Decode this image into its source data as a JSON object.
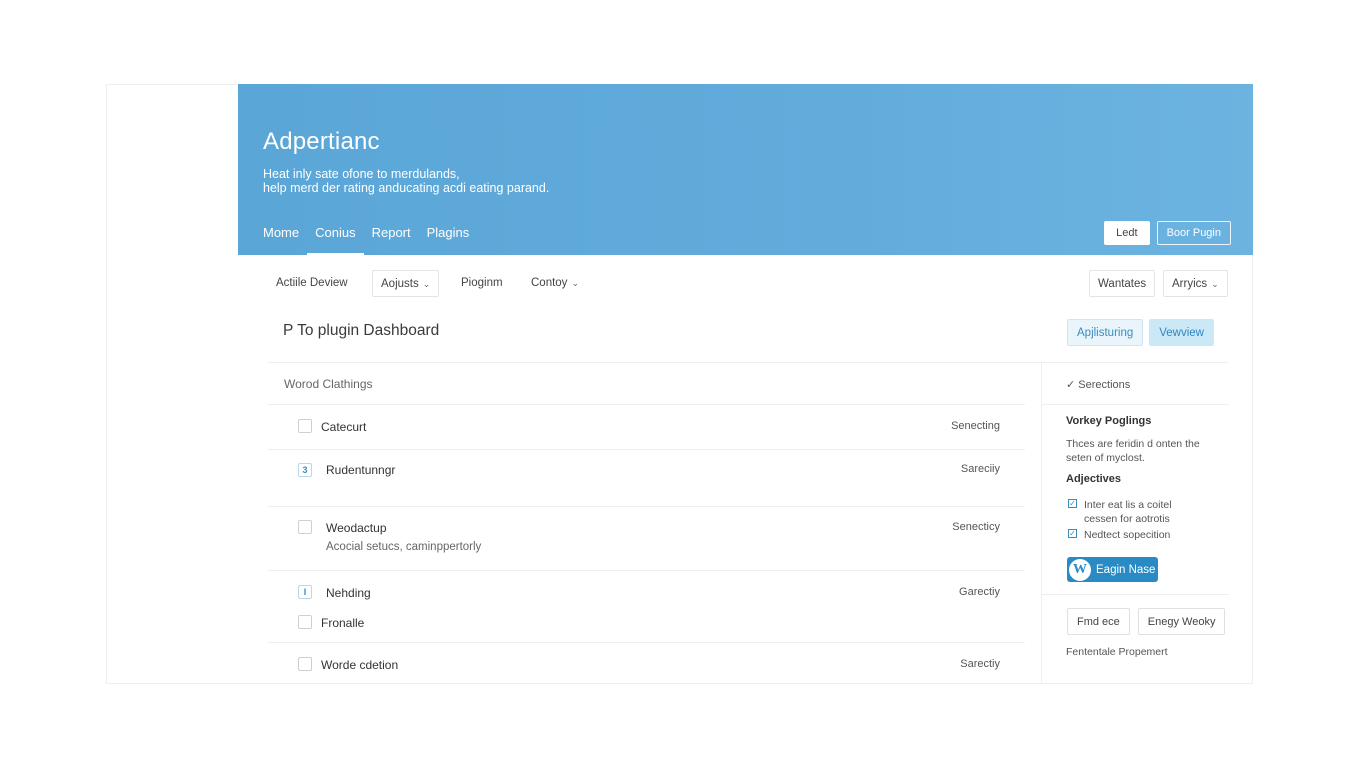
{
  "hero": {
    "title": "Adpertianc",
    "subtitle_line1": "Heat inly sate ofone to merdulands,",
    "subtitle_line2": "help merd der rating anducating acdi eating parand.",
    "nav": [
      "Mome",
      "Conius",
      "Report",
      "Plagins"
    ],
    "active_nav": "Conius",
    "btn_primary": "Ledt",
    "btn_secondary": "Boor Pugin"
  },
  "toolbar": {
    "items": [
      "Actiile Deview",
      "Aojusts",
      "Pioginm",
      "Contoy"
    ],
    "right_items": [
      "Wantates",
      "Arryics"
    ]
  },
  "page": {
    "title": "P To plugin Dashboard",
    "btn_1": "Apjlisturing",
    "btn_2": "Vewview"
  },
  "list": {
    "header": "Worod Clathings",
    "rows": [
      {
        "label": "Catecurt",
        "sub": "",
        "status": "Senecting",
        "marked": false,
        "mark": ""
      },
      {
        "label": "Rudentunngr",
        "sub": "",
        "status": "Sareciiy",
        "marked": true,
        "mark": "3"
      },
      {
        "label": "Weodactup",
        "sub": "Acocial setucs, caminppertorly",
        "status": "Senecticy",
        "marked": false,
        "mark": ""
      },
      {
        "label": "Nehding",
        "sub": "",
        "status": "Garectiy",
        "marked": true,
        "mark": "I"
      },
      {
        "label": "Fronalle",
        "sub": "",
        "status": "",
        "marked": false,
        "mark": ""
      },
      {
        "label": "Worde cdetion",
        "sub": "",
        "status": "Sarectiy",
        "marked": false,
        "mark": ""
      }
    ]
  },
  "side": {
    "top": "Serections",
    "heading1": "Vorkey Poglings",
    "para_line1": "Thces are feridin d onten the",
    "para_line2": "seten of myclost.",
    "heading2": "Adjectives",
    "check1_line1": "Inter eat lis a coitel",
    "check1_line2": "cessen for aotrotis",
    "check2": "Nedtect sopecition",
    "wp_button": "Eagin Nase",
    "btn_a": "Fmd ece",
    "btn_b": "Enegy Weoky",
    "footer": "Fententale Propemert"
  },
  "colors": {
    "hero_blue": "#5aa6d6",
    "logo_orange": "#f2a516",
    "wp_blue": "#2a8bc4"
  },
  "icons": {
    "logo": "maple-leaf-icon",
    "wordpress": "wordpress-icon",
    "check": "check-icon",
    "chevron": "chevron-down-icon"
  }
}
